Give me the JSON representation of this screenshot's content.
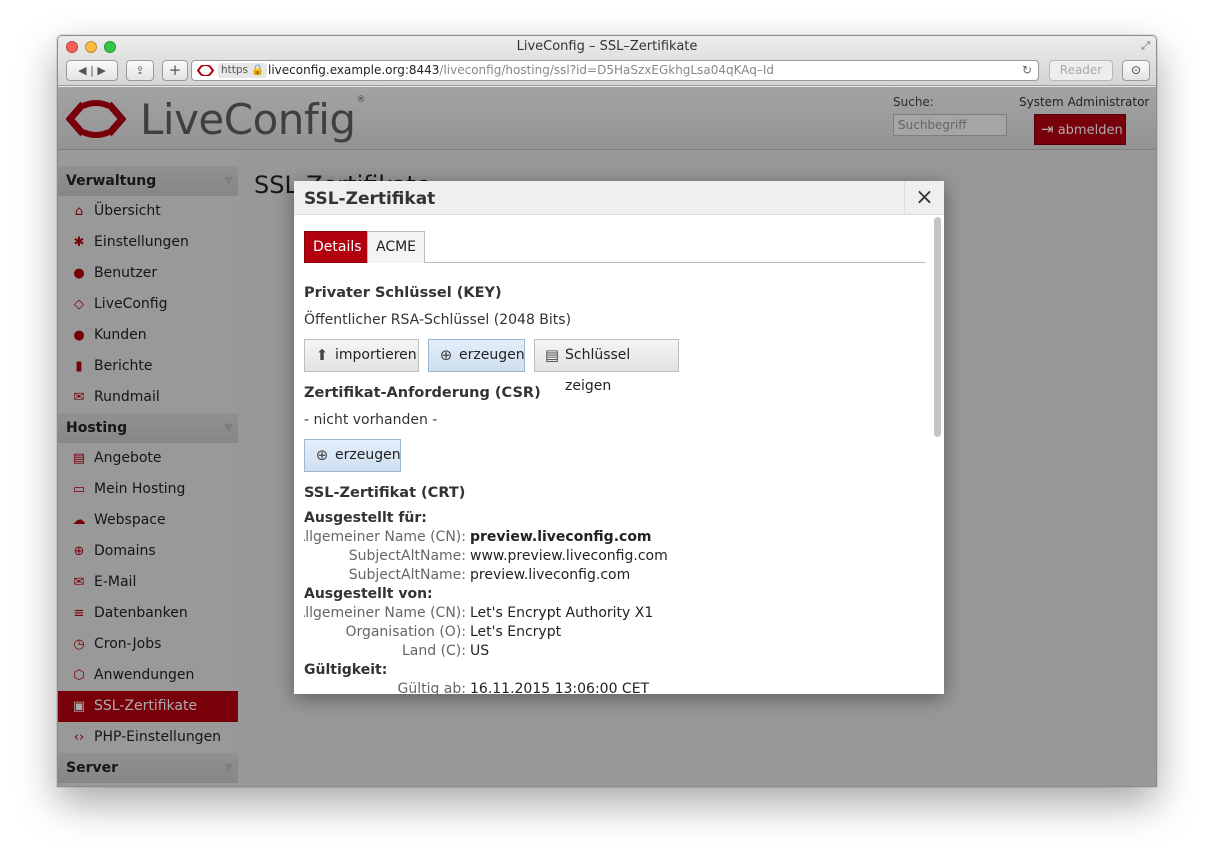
{
  "window": {
    "title": "LiveConfig – SSL–Zertifikate"
  },
  "browser": {
    "url_scheme": "https",
    "url_host": "liveconfig.example.org:8443",
    "url_path": "/liveconfig/hosting/ssl?id=D5HaSzxEGkhgLsa04qKAq–Id",
    "reader_label": "Reader"
  },
  "app": {
    "logo_text": "LiveConfig",
    "logo_mark": "®",
    "search_label": "Suche:",
    "search_placeholder": "Suchbegriff",
    "user_name": "System Administrator",
    "logout_label": "abmelden"
  },
  "sidebar": {
    "sections": [
      {
        "label": "Verwaltung",
        "items": [
          {
            "label": "Übersicht",
            "icon": "home-icon",
            "glyph": "⌂"
          },
          {
            "label": "Einstellungen",
            "icon": "gear-icon",
            "glyph": "✱"
          },
          {
            "label": "Benutzer",
            "icon": "user-icon",
            "glyph": "●"
          },
          {
            "label": "LiveConfig",
            "icon": "liveconfig-icon",
            "glyph": "◇"
          },
          {
            "label": "Kunden",
            "icon": "customers-icon",
            "glyph": "●"
          },
          {
            "label": "Berichte",
            "icon": "chart-icon",
            "glyph": "▮"
          },
          {
            "label": "Rundmail",
            "icon": "mail-icon",
            "glyph": "✉"
          }
        ]
      },
      {
        "label": "Hosting",
        "items": [
          {
            "label": "Angebote",
            "icon": "offers-icon",
            "glyph": "▤"
          },
          {
            "label": "Mein Hosting",
            "icon": "monitor-icon",
            "glyph": "▭"
          },
          {
            "label": "Webspace",
            "icon": "cloud-icon",
            "glyph": "☁"
          },
          {
            "label": "Domains",
            "icon": "globe-icon",
            "glyph": "⊕"
          },
          {
            "label": "E-Mail",
            "icon": "mail-icon",
            "glyph": "✉"
          },
          {
            "label": "Datenbanken",
            "icon": "database-icon",
            "glyph": "≡"
          },
          {
            "label": "Cron-Jobs",
            "icon": "clock-icon",
            "glyph": "◷"
          },
          {
            "label": "Anwendungen",
            "icon": "package-icon",
            "glyph": "⬡"
          },
          {
            "label": "SSL-Zertifikate",
            "icon": "lock-icon",
            "glyph": "▣",
            "active": true
          },
          {
            "label": "PHP-Einstellungen",
            "icon": "code-icon",
            "glyph": "‹›"
          }
        ]
      },
      {
        "label": "Server",
        "items": []
      }
    ]
  },
  "main": {
    "page_title": "SSL-Zertifikate"
  },
  "modal": {
    "title": "SSL-Zertifikat",
    "close": "×",
    "tabs": [
      {
        "label": "Details"
      },
      {
        "label": "ACME"
      }
    ],
    "key": {
      "heading": "Privater Schlüssel (KEY)",
      "desc": "Öffentlicher RSA-Schlüssel (2048 Bits)",
      "import_label": "importieren",
      "generate_label": "erzeugen",
      "show_label": "Schlüssel zeigen"
    },
    "csr": {
      "heading": "Zertifikat-Anforderung (CSR)",
      "desc": "- nicht vorhanden -",
      "generate_label": "erzeugen"
    },
    "crt": {
      "heading": "SSL-Zertifikat (CRT)",
      "issued_to_label": "Ausgestellt für:",
      "cn_label": "Allgemeiner Name (CN):",
      "cn_value": "preview.liveconfig.com",
      "san_label": "SubjectAltName:",
      "san1": "www.preview.liveconfig.com",
      "san2": "preview.liveconfig.com",
      "issued_by_label": "Ausgestellt von:",
      "issuer_cn_label": "Allgemeiner Name (CN):",
      "issuer_cn_value": "Let's Encrypt Authority X1",
      "org_label": "Organisation (O):",
      "org_value": "Let's Encrypt",
      "country_label": "Land (C):",
      "country_value": "US",
      "validity_label": "Gültigkeit:",
      "valid_from_label": "Gültig ab:",
      "valid_from_value": "16.11.2015 13:06:00 CET"
    }
  }
}
